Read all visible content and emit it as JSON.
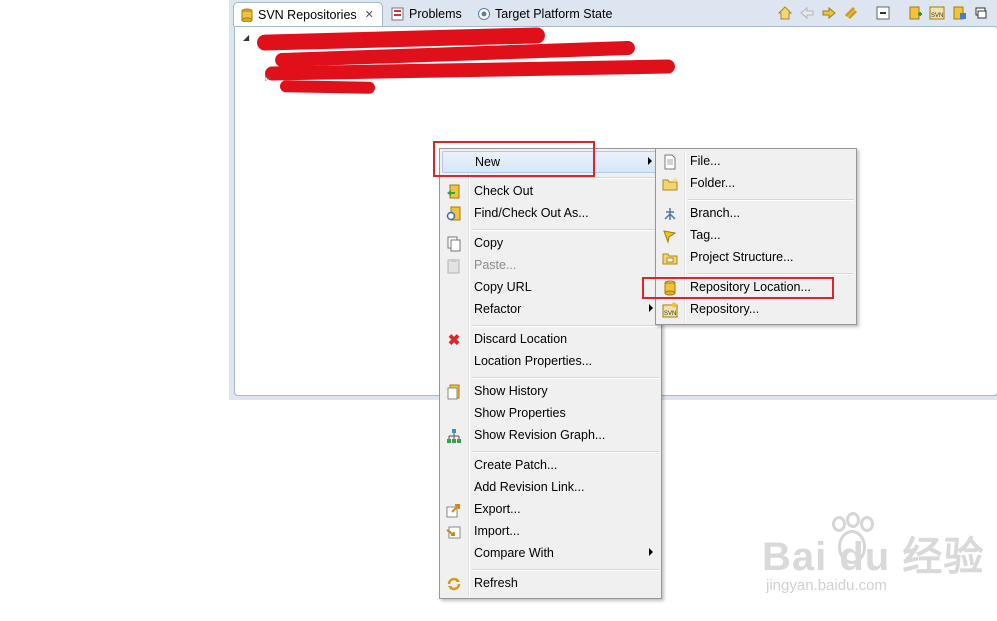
{
  "tabs": [
    {
      "label": "SVN Repositories",
      "icon": "svn-repositories-icon",
      "active": true
    },
    {
      "label": "Problems",
      "icon": "problems-icon",
      "active": false
    },
    {
      "label": "Target Platform State",
      "icon": "target-platform-icon",
      "active": false
    }
  ],
  "toolbar_icons": [
    "home-icon",
    "back-icon",
    "forward-icon",
    "link-icon",
    "collapse-all-icon",
    "new-location-icon",
    "svn-import-icon",
    "properties-icon",
    "minimize-icon"
  ],
  "context_menu": {
    "items": [
      {
        "label": "New",
        "icon": "",
        "submenu": true,
        "highlighted": true
      },
      {
        "label": "Check Out",
        "icon": "checkout-icon"
      },
      {
        "label": "Find/Check Out As...",
        "icon": "find-checkout-icon"
      },
      {
        "label": "Copy",
        "icon": "copy-icon"
      },
      {
        "label": "Paste...",
        "icon": "paste-icon",
        "disabled": true
      },
      {
        "label": "Copy URL",
        "icon": ""
      },
      {
        "label": "Refactor",
        "icon": "",
        "submenu": true
      },
      {
        "label": "Discard Location",
        "icon": "discard-icon"
      },
      {
        "label": "Location Properties...",
        "icon": ""
      },
      {
        "label": "Show History",
        "icon": "history-icon"
      },
      {
        "label": "Show Properties",
        "icon": ""
      },
      {
        "label": "Show Revision Graph...",
        "icon": "revision-graph-icon"
      },
      {
        "label": "Create Patch...",
        "icon": ""
      },
      {
        "label": "Add Revision Link...",
        "icon": ""
      },
      {
        "label": "Export...",
        "icon": "export-icon"
      },
      {
        "label": "Import...",
        "icon": "import-icon"
      },
      {
        "label": "Compare With",
        "icon": "",
        "submenu": true
      },
      {
        "label": "Refresh",
        "icon": "refresh-icon"
      }
    ]
  },
  "submenu": {
    "items": [
      {
        "label": "File...",
        "icon": "file-icon"
      },
      {
        "label": "Folder...",
        "icon": "folder-icon"
      },
      {
        "label": "Branch...",
        "icon": "branch-icon"
      },
      {
        "label": "Tag...",
        "icon": "tag-icon"
      },
      {
        "label": "Project Structure...",
        "icon": "project-structure-icon"
      },
      {
        "label": "Repository Location...",
        "icon": "repository-location-icon"
      },
      {
        "label": "Repository...",
        "icon": "svn-repository-icon"
      }
    ]
  },
  "watermark": {
    "brand": "Bai du 经验",
    "url": "jingyan.baidu.com"
  },
  "colors": {
    "highlight_box": "#d8262c",
    "redaction": "#e0101a",
    "panel": "#dde6f0"
  }
}
